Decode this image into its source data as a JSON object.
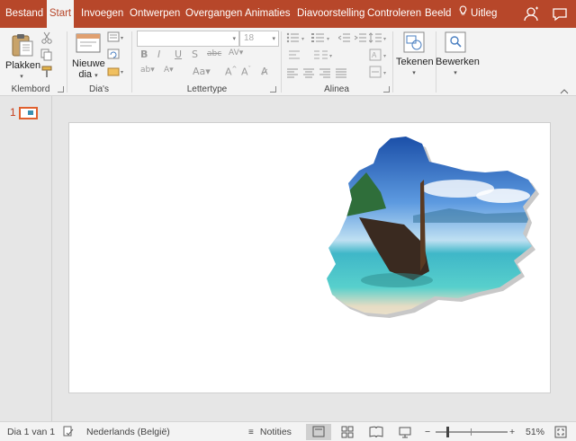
{
  "tabs": [
    {
      "label": "Bestand",
      "active": false
    },
    {
      "label": "Start",
      "active": true
    },
    {
      "label": "Invoegen",
      "active": false
    },
    {
      "label": "Ontwerpen",
      "active": false
    },
    {
      "label": "Overgangen",
      "active": false
    },
    {
      "label": "Animaties",
      "active": false
    },
    {
      "label": "Diavoorstelling",
      "active": false
    },
    {
      "label": "Controleren",
      "active": false
    },
    {
      "label": "Beeld",
      "active": false
    }
  ],
  "tell_me": "Uitleg",
  "ribbon": {
    "groups": {
      "clipboard": "Klembord",
      "slides": "Dia's",
      "font": "Lettertype",
      "paragraph": "Alinea"
    },
    "paste_label": "Plakken",
    "new_slide_label": "Nieuwe",
    "new_slide_label2": "dia",
    "font_size": "18",
    "drawing_label": "Tekenen",
    "editing_label": "Bewerken"
  },
  "thumbnails": [
    {
      "number": "1"
    }
  ],
  "status": {
    "slide_info": "Dia 1 van 1",
    "language": "Nederlands (België)",
    "notes": "Notities",
    "zoom": "51%",
    "zoom_minus": "−",
    "zoom_plus": "+"
  },
  "colors": {
    "accent": "#b7472a",
    "ribbon_bg": "#f3f3f3",
    "workspace": "#e6e6e6"
  }
}
